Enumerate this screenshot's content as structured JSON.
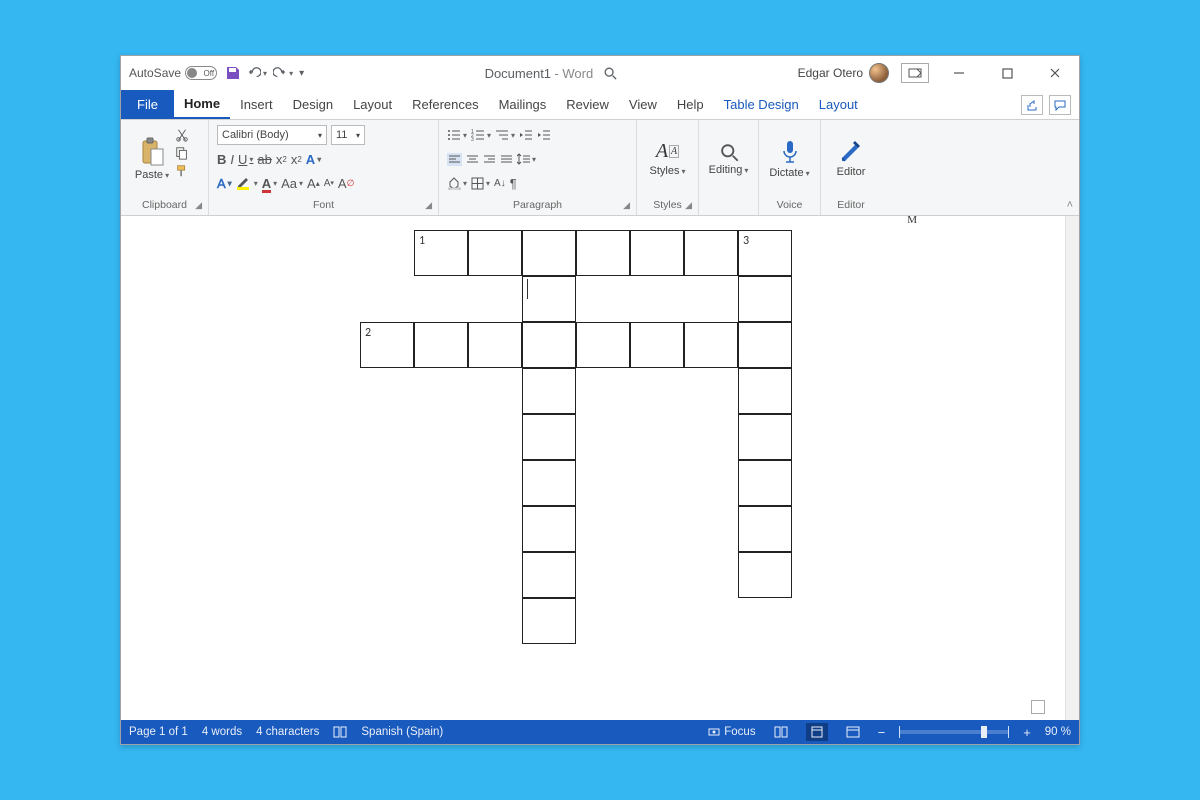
{
  "titlebar": {
    "autosave_label": "AutoSave",
    "autosave_state": "Off",
    "doc_title": "Document1",
    "app_name": "Word",
    "user_name": "Edgar Otero"
  },
  "tabs": {
    "file": "File",
    "list": [
      "Home",
      "Insert",
      "Design",
      "Layout",
      "References",
      "Mailings",
      "Review",
      "View",
      "Help"
    ],
    "context": [
      "Table Design",
      "Layout"
    ],
    "active": "Home"
  },
  "ribbon": {
    "clipboard": {
      "paste": "Paste",
      "label": "Clipboard"
    },
    "font": {
      "name": "Calibri (Body)",
      "size": "11",
      "label": "Font"
    },
    "paragraph": {
      "label": "Paragraph"
    },
    "styles": {
      "btn": "Styles",
      "label": "Styles"
    },
    "editing": {
      "btn": "Editing",
      "label": ""
    },
    "voice": {
      "btn": "Dictate",
      "label": "Voice"
    },
    "editor": {
      "btn": "Editor",
      "label": "Editor"
    }
  },
  "document": {
    "ruler_mark": "M",
    "clues": {
      "c1": "1",
      "c2": "2",
      "c3": "3"
    }
  },
  "status": {
    "page": "Page 1 of 1",
    "words": "4 words",
    "chars": "4 characters",
    "language": "Spanish (Spain)",
    "focus": "Focus",
    "zoom": "90 %"
  }
}
